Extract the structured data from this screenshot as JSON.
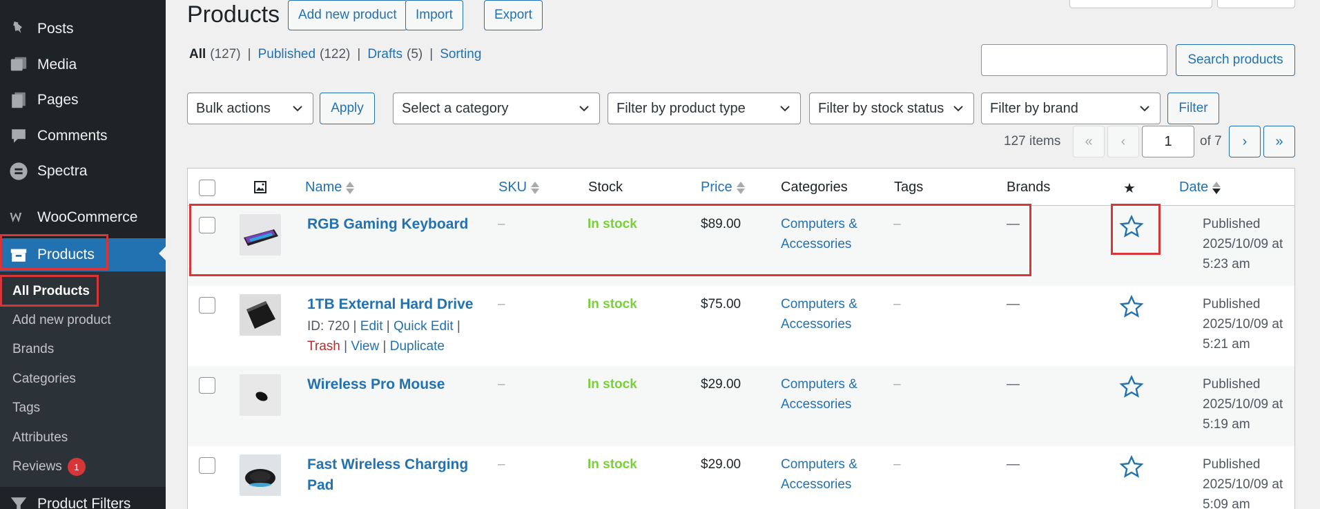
{
  "sidebar": {
    "items": [
      {
        "label": "Posts",
        "icon": "pin-icon"
      },
      {
        "label": "Media",
        "icon": "media-icon"
      },
      {
        "label": "Pages",
        "icon": "pages-icon"
      },
      {
        "label": "Comments",
        "icon": "comments-icon"
      },
      {
        "label": "Spectra",
        "icon": "spectra-icon"
      },
      {
        "label": "WooCommerce",
        "icon": "woocommerce-icon"
      },
      {
        "label": "Products",
        "icon": "products-icon"
      },
      {
        "label": "Product Filters",
        "icon": "filter-icon"
      }
    ],
    "submenu": [
      {
        "label": "All Products"
      },
      {
        "label": "Add new product"
      },
      {
        "label": "Brands"
      },
      {
        "label": "Categories"
      },
      {
        "label": "Tags"
      },
      {
        "label": "Attributes"
      },
      {
        "label": "Reviews",
        "badge": "1"
      }
    ]
  },
  "header": {
    "title": "Products",
    "add_new": "Add new product",
    "import": "Import",
    "export": "Export"
  },
  "views": {
    "all": "All",
    "all_count": "(127)",
    "published": "Published",
    "published_count": "(122)",
    "drafts": "Drafts",
    "drafts_count": "(5)",
    "sorting": "Sorting",
    "separator": "|"
  },
  "search": {
    "button": "Search products",
    "value": ""
  },
  "filters": {
    "bulk_actions": "Bulk actions",
    "apply": "Apply",
    "category": "Select a category",
    "product_type": "Filter by product type",
    "stock_status": "Filter by stock status",
    "brand": "Filter by brand",
    "filter_button": "Filter"
  },
  "pagination": {
    "items": "127 items",
    "first": "«",
    "prev": "‹",
    "current": "1",
    "of": "of 7",
    "next": "›",
    "last": "»"
  },
  "table": {
    "columns": {
      "name": "Name",
      "sku": "SKU",
      "stock": "Stock",
      "price": "Price",
      "categories": "Categories",
      "tags": "Tags",
      "brands": "Brands",
      "featured": "★",
      "date": "Date"
    },
    "rows": [
      {
        "name": "RGB Gaming Keyboard",
        "name2": "",
        "sku": "–",
        "stock": "In stock",
        "price": "$89.00",
        "cat1": "Computers &",
        "cat2": "Accessories",
        "tags": "–",
        "brands": "—",
        "status": "Published",
        "date": "2025/10/09 at",
        "time": "5:23 am"
      },
      {
        "name": "1TB External Hard Drive",
        "name2": "",
        "sku": "–",
        "stock": "In stock",
        "price": "$75.00",
        "cat1": "Computers &",
        "cat2": "Accessories",
        "tags": "–",
        "brands": "—",
        "status": "Published",
        "date": "2025/10/09 at",
        "time": "5:21 am",
        "actions": {
          "id": "ID: 720",
          "edit": "Edit",
          "quick_edit": "Quick Edit",
          "trash": "Trash",
          "view": "View",
          "duplicate": "Duplicate",
          "sep": "|"
        }
      },
      {
        "name": "Wireless Pro Mouse",
        "name2": "",
        "sku": "–",
        "stock": "In stock",
        "price": "$29.00",
        "cat1": "Computers &",
        "cat2": "Accessories",
        "tags": "–",
        "brands": "—",
        "status": "Published",
        "date": "2025/10/09 at",
        "time": "5:19 am"
      },
      {
        "name": "Fast Wireless Charging",
        "name2": "Pad",
        "sku": "–",
        "stock": "In stock",
        "price": "$29.00",
        "cat1": "Computers &",
        "cat2": "Accessories",
        "tags": "–",
        "brands": "—",
        "status": "Published",
        "date": "2025/10/09 at",
        "time": "5:09 am"
      }
    ]
  },
  "colors": {
    "sidebar_bg": "#1d2327",
    "accent": "#2271b1",
    "stock_green": "#7ad03a",
    "highlight_red": "#d63638"
  }
}
